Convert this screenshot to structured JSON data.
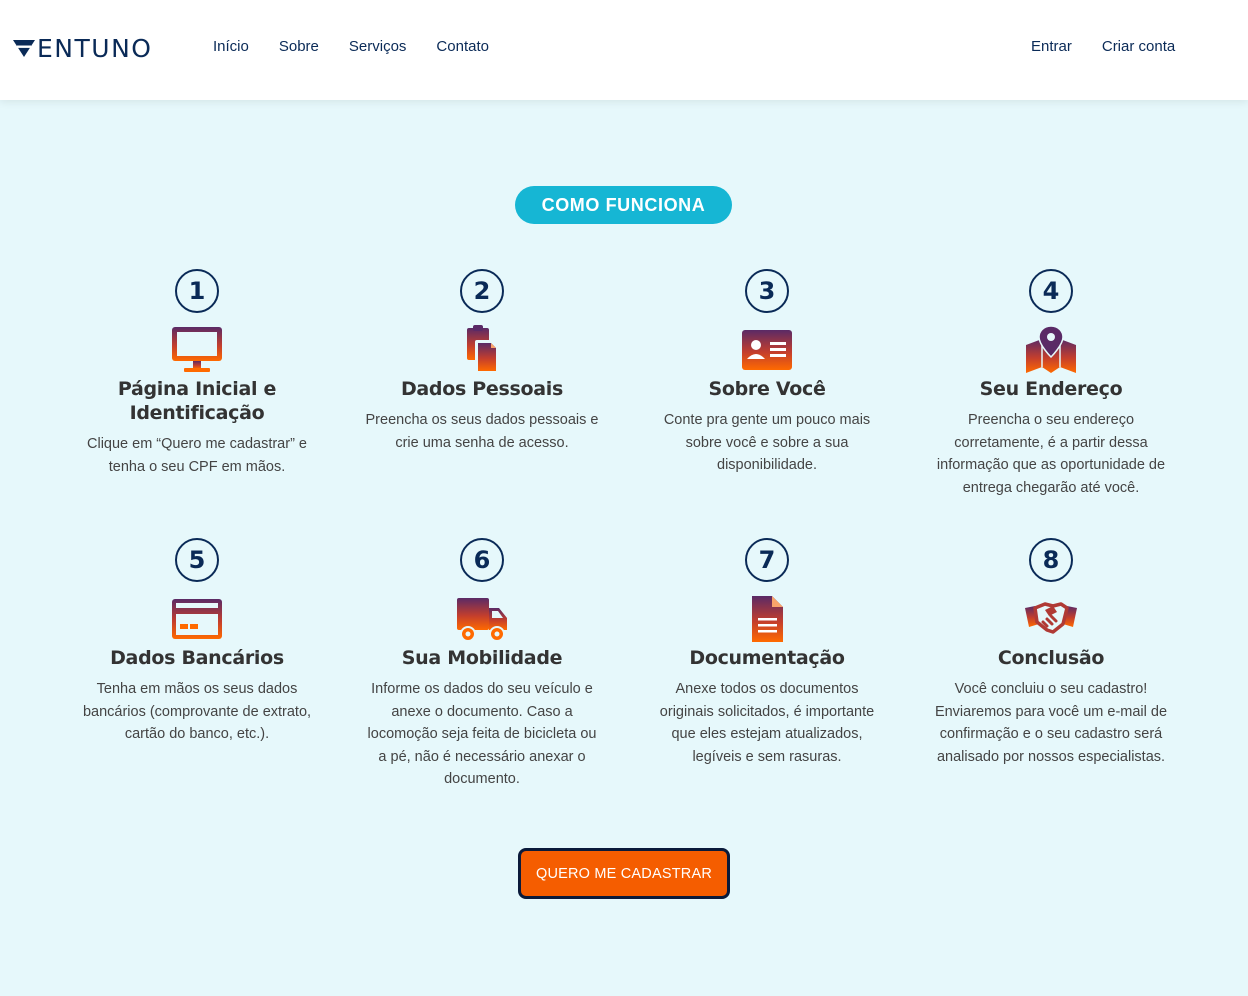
{
  "brand": {
    "name": "ENTUNO",
    "logo_glyph": "V"
  },
  "nav": {
    "items": [
      "Início",
      "Sobre",
      "Serviços",
      "Contato"
    ]
  },
  "auth": {
    "login": "Entrar",
    "signup": "Criar conta"
  },
  "section": {
    "badge": "COMO FUNCIONA"
  },
  "steps": [
    {
      "number": "1",
      "icon": "monitor-icon",
      "title": "Página Inicial e Identificação",
      "text": "Clique em “Quero me cadastrar” e tenha o seu CPF em mãos."
    },
    {
      "number": "2",
      "icon": "documents-icon",
      "title": "Dados Pessoais",
      "text": "Preencha os seus dados pessoais e crie uma senha de acesso."
    },
    {
      "number": "3",
      "icon": "id-card-icon",
      "title": "Sobre Você",
      "text": "Conte pra gente um pouco mais sobre você e sobre a sua disponibilidade."
    },
    {
      "number": "4",
      "icon": "map-pin-icon",
      "title": "Seu Endereço",
      "text": "Preencha o seu endereço corretamente, é a partir dessa informação que as oportunidade de entrega chegarão até você."
    },
    {
      "number": "5",
      "icon": "credit-card-icon",
      "title": "Dados Bancários",
      "text": "Tenha em mãos os seus dados bancários (comprovante de extrato, cartão do banco, etc.)."
    },
    {
      "number": "6",
      "icon": "truck-icon",
      "title": "Sua Mobilidade",
      "text": "Informe os dados do seu veículo e anexe o documento. Caso a locomoção seja feita de bicicleta ou a pé, não é necessário anexar o documento."
    },
    {
      "number": "7",
      "icon": "document-icon",
      "title": "Documentação",
      "text": "Anexe todos os documentos originais solicitados, é importante que eles estejam atualizados, legíveis e sem rasuras."
    },
    {
      "number": "8",
      "icon": "handshake-icon",
      "title": "Conclusão",
      "text": "Você concluiu o seu cadastro! Enviaremos para você um e-mail de confirmação e o seu cadastro será analisado por nossos especialistas."
    }
  ],
  "cta": {
    "label": "QUERO ME CADASTRAR"
  },
  "colors": {
    "navy": "#0a2a57",
    "cyan": "#16b6d4",
    "orange": "#f55d00",
    "gradient_top": "#5a2a66",
    "gradient_bottom": "#ff6a00",
    "background": "#e6f8fb"
  }
}
